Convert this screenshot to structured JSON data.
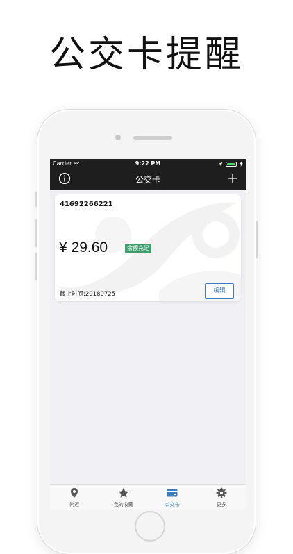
{
  "promo": {
    "title": "公交卡提醒"
  },
  "status_bar": {
    "carrier": "Carrier",
    "time": "9:22 PM"
  },
  "nav": {
    "title": "公交卡"
  },
  "card": {
    "number": "41692266221",
    "balance": "¥ 29.60",
    "badge": "余额充足",
    "expiry": "截止时间:20180725",
    "edit_label": "编辑"
  },
  "tabs": [
    {
      "label": "附近",
      "icon": "location-pin-icon",
      "active": false
    },
    {
      "label": "我的收藏",
      "icon": "star-icon",
      "active": false
    },
    {
      "label": "公交卡",
      "icon": "card-icon",
      "active": true
    },
    {
      "label": "更多",
      "icon": "gear-icon",
      "active": false
    }
  ],
  "colors": {
    "nav_background": "#1e1e1e",
    "badge_green": "#3f9e6e",
    "accent_blue": "#3b7bbf",
    "screen_background": "#efeff4"
  }
}
